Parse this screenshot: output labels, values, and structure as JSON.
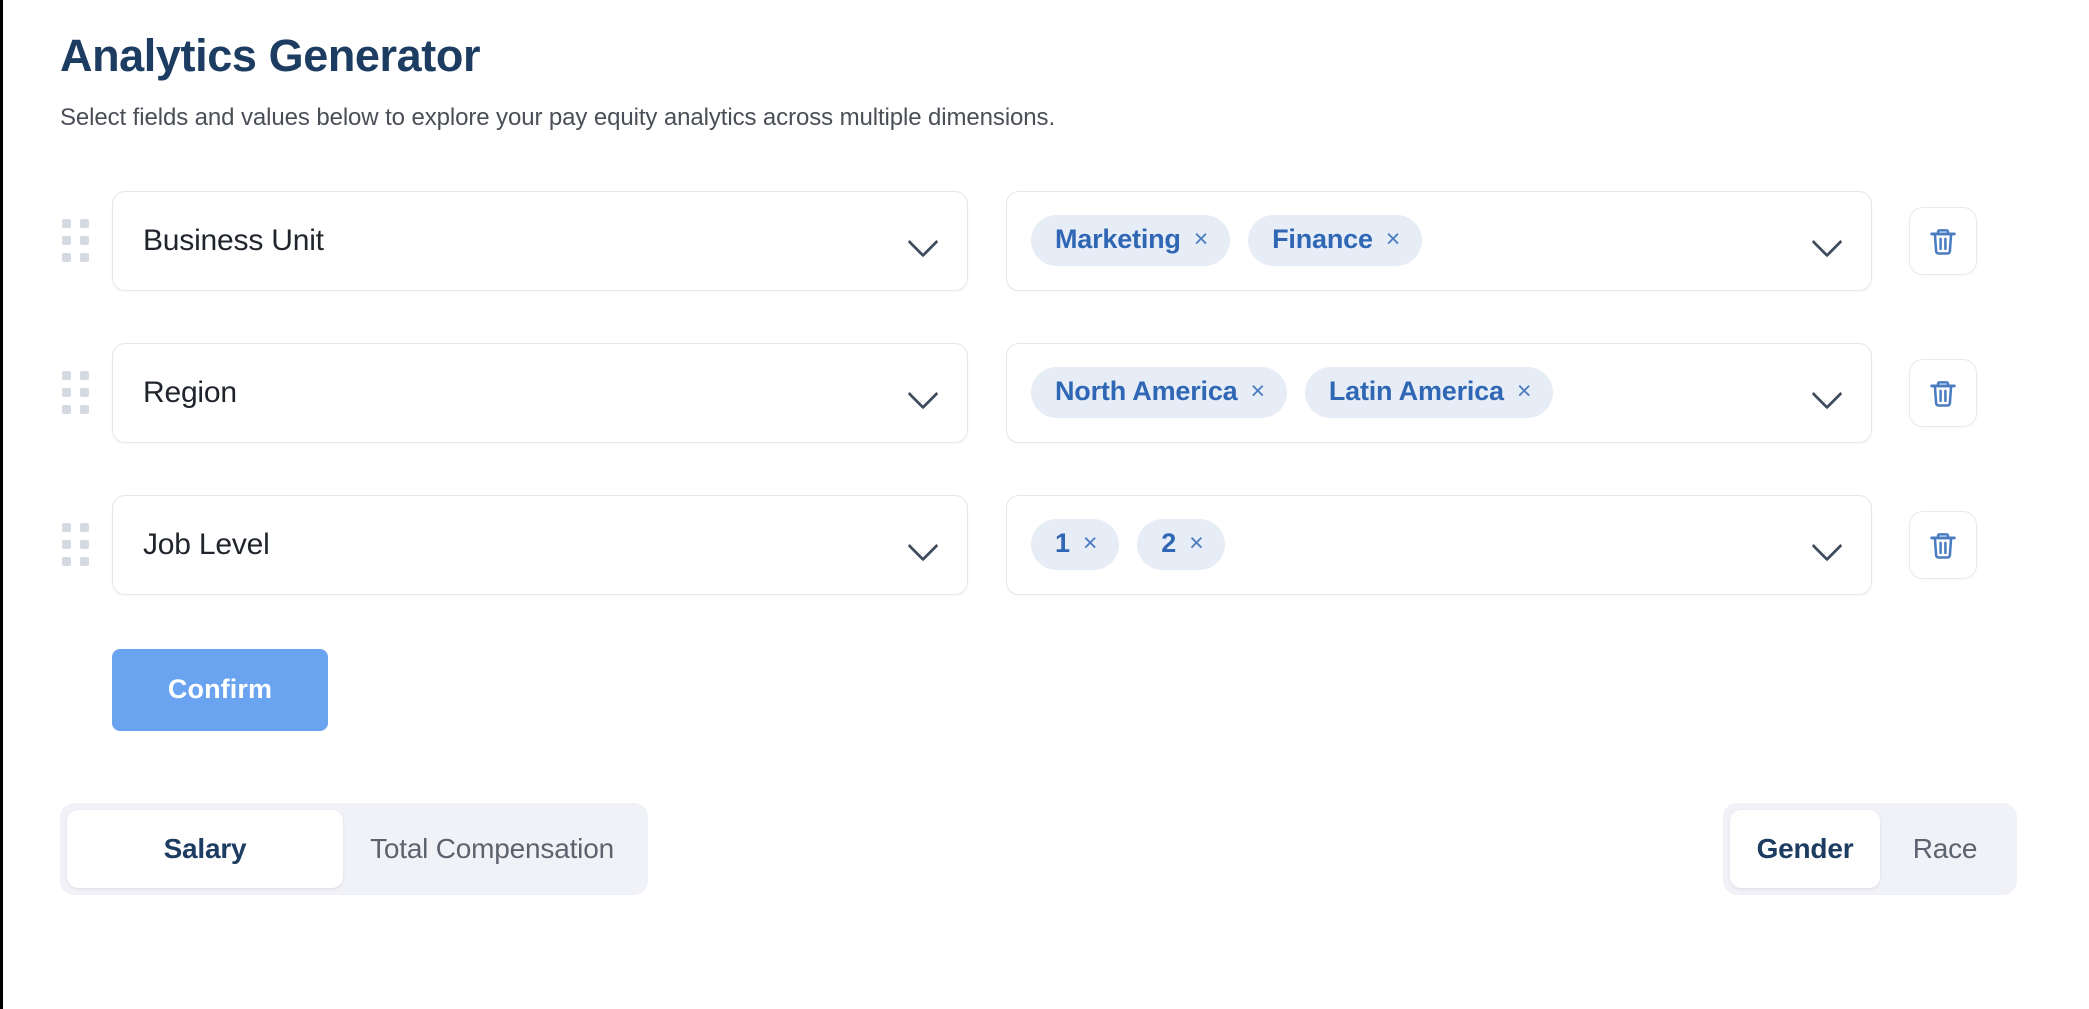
{
  "header": {
    "title": "Analytics Generator",
    "subtitle": "Select fields and values below to explore your pay equity analytics across multiple dimensions."
  },
  "colors": {
    "title": "#1c3c61",
    "accent_button": "#6aa4f0",
    "chip_bg": "#e7edf7",
    "chip_text": "#2f67b5",
    "trash_icon": "#4a7cc0",
    "segmented_track": "#f1f2f7"
  },
  "filters": {
    "rows": [
      {
        "drag_handle": "drag-handle-icon",
        "field": "Business Unit",
        "field_chevron": "chevron-down-icon",
        "values": [
          {
            "label": "Marketing",
            "remove": "×"
          },
          {
            "label": "Finance",
            "remove": "×"
          }
        ],
        "values_chevron": "chevron-down-icon",
        "delete": "trash-icon"
      },
      {
        "drag_handle": "drag-handle-icon",
        "field": "Region",
        "field_chevron": "chevron-down-icon",
        "values": [
          {
            "label": "North America",
            "remove": "×"
          },
          {
            "label": "Latin America",
            "remove": "×"
          }
        ],
        "values_chevron": "chevron-down-icon",
        "delete": "trash-icon"
      },
      {
        "drag_handle": "drag-handle-icon",
        "field": "Job Level",
        "field_chevron": "chevron-down-icon",
        "values": [
          {
            "label": "1",
            "remove": "×"
          },
          {
            "label": "2",
            "remove": "×"
          }
        ],
        "values_chevron": "chevron-down-icon",
        "delete": "trash-icon"
      }
    ]
  },
  "actions": {
    "confirm_label": "Confirm"
  },
  "toggles": {
    "metric": {
      "options": [
        "Salary",
        "Total Compensation"
      ],
      "selected": "Salary"
    },
    "demographic": {
      "options": [
        "Gender",
        "Race"
      ],
      "selected": "Gender"
    }
  }
}
